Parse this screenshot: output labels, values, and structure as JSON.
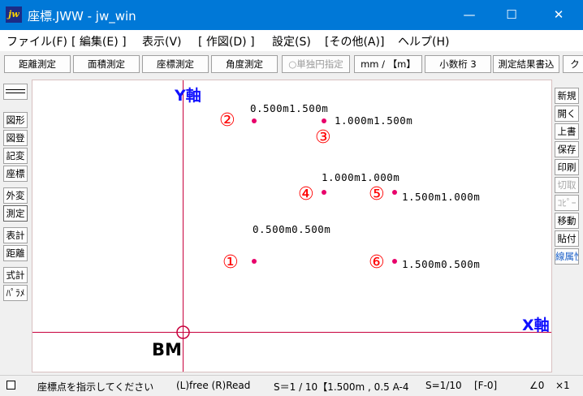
{
  "window": {
    "icon": "jw",
    "title": "座標.JWW - jw_win",
    "minimize": "—",
    "maximize": "☐",
    "close": "✕"
  },
  "menu": [
    "ファイル(F)",
    "[ 編集(E) ]",
    "表示(V)",
    "[ 作図(D) ]",
    "設定(S)",
    "[その他(A)]",
    "ヘルプ(H)"
  ],
  "toolbar": {
    "distance": "距離測定",
    "area": "面積測定",
    "coordinate": "座標測定",
    "angle": "角度測定",
    "single_arc": "○単独円指定",
    "unit": "mm / 【m】",
    "decimal": "小数桁 3",
    "write_result": "測定結果書込",
    "overflow": "ク"
  },
  "left_tools": [
    "図形",
    "図登",
    "記変",
    "座標",
    "外変",
    "測定",
    "表計",
    "距離",
    "式計",
    "ﾊﾟﾗﾒ"
  ],
  "right_tools": [
    "新規",
    "開く",
    "上書",
    "保存",
    "印刷",
    "切取",
    "ｺﾋﾟｰ",
    "移動",
    "貼付",
    "線属性"
  ],
  "canvas": {
    "y_axis_label": "Y軸",
    "x_axis_label": "X軸",
    "bm_label": "BM",
    "points": [
      {
        "marker": "①",
        "coord": "0.500m0.500m"
      },
      {
        "marker": "②",
        "coord": "0.500m1.500m"
      },
      {
        "marker": "③",
        "coord": "1.000m1.500m"
      },
      {
        "marker": "④",
        "coord": "1.000m1.000m"
      },
      {
        "marker": "⑤",
        "coord": "1.500m1.000m"
      },
      {
        "marker": "⑥",
        "coord": "1.500m0.500m"
      }
    ]
  },
  "status": {
    "message": "座標点を指示してください",
    "mode": "(L)free (R)Read",
    "scale": "S＝1 / 10【1.500m , 0.5 A-4",
    "scale2": "S=1/10",
    "layer": "[F-0]",
    "angle": "∠0",
    "zoom": "×1"
  },
  "colors": {
    "titlebar": "#0078d7",
    "axis_line": "#c8003c",
    "axis_label": "#1010ff",
    "marker": "#ff0000",
    "point": "#e8006a"
  }
}
